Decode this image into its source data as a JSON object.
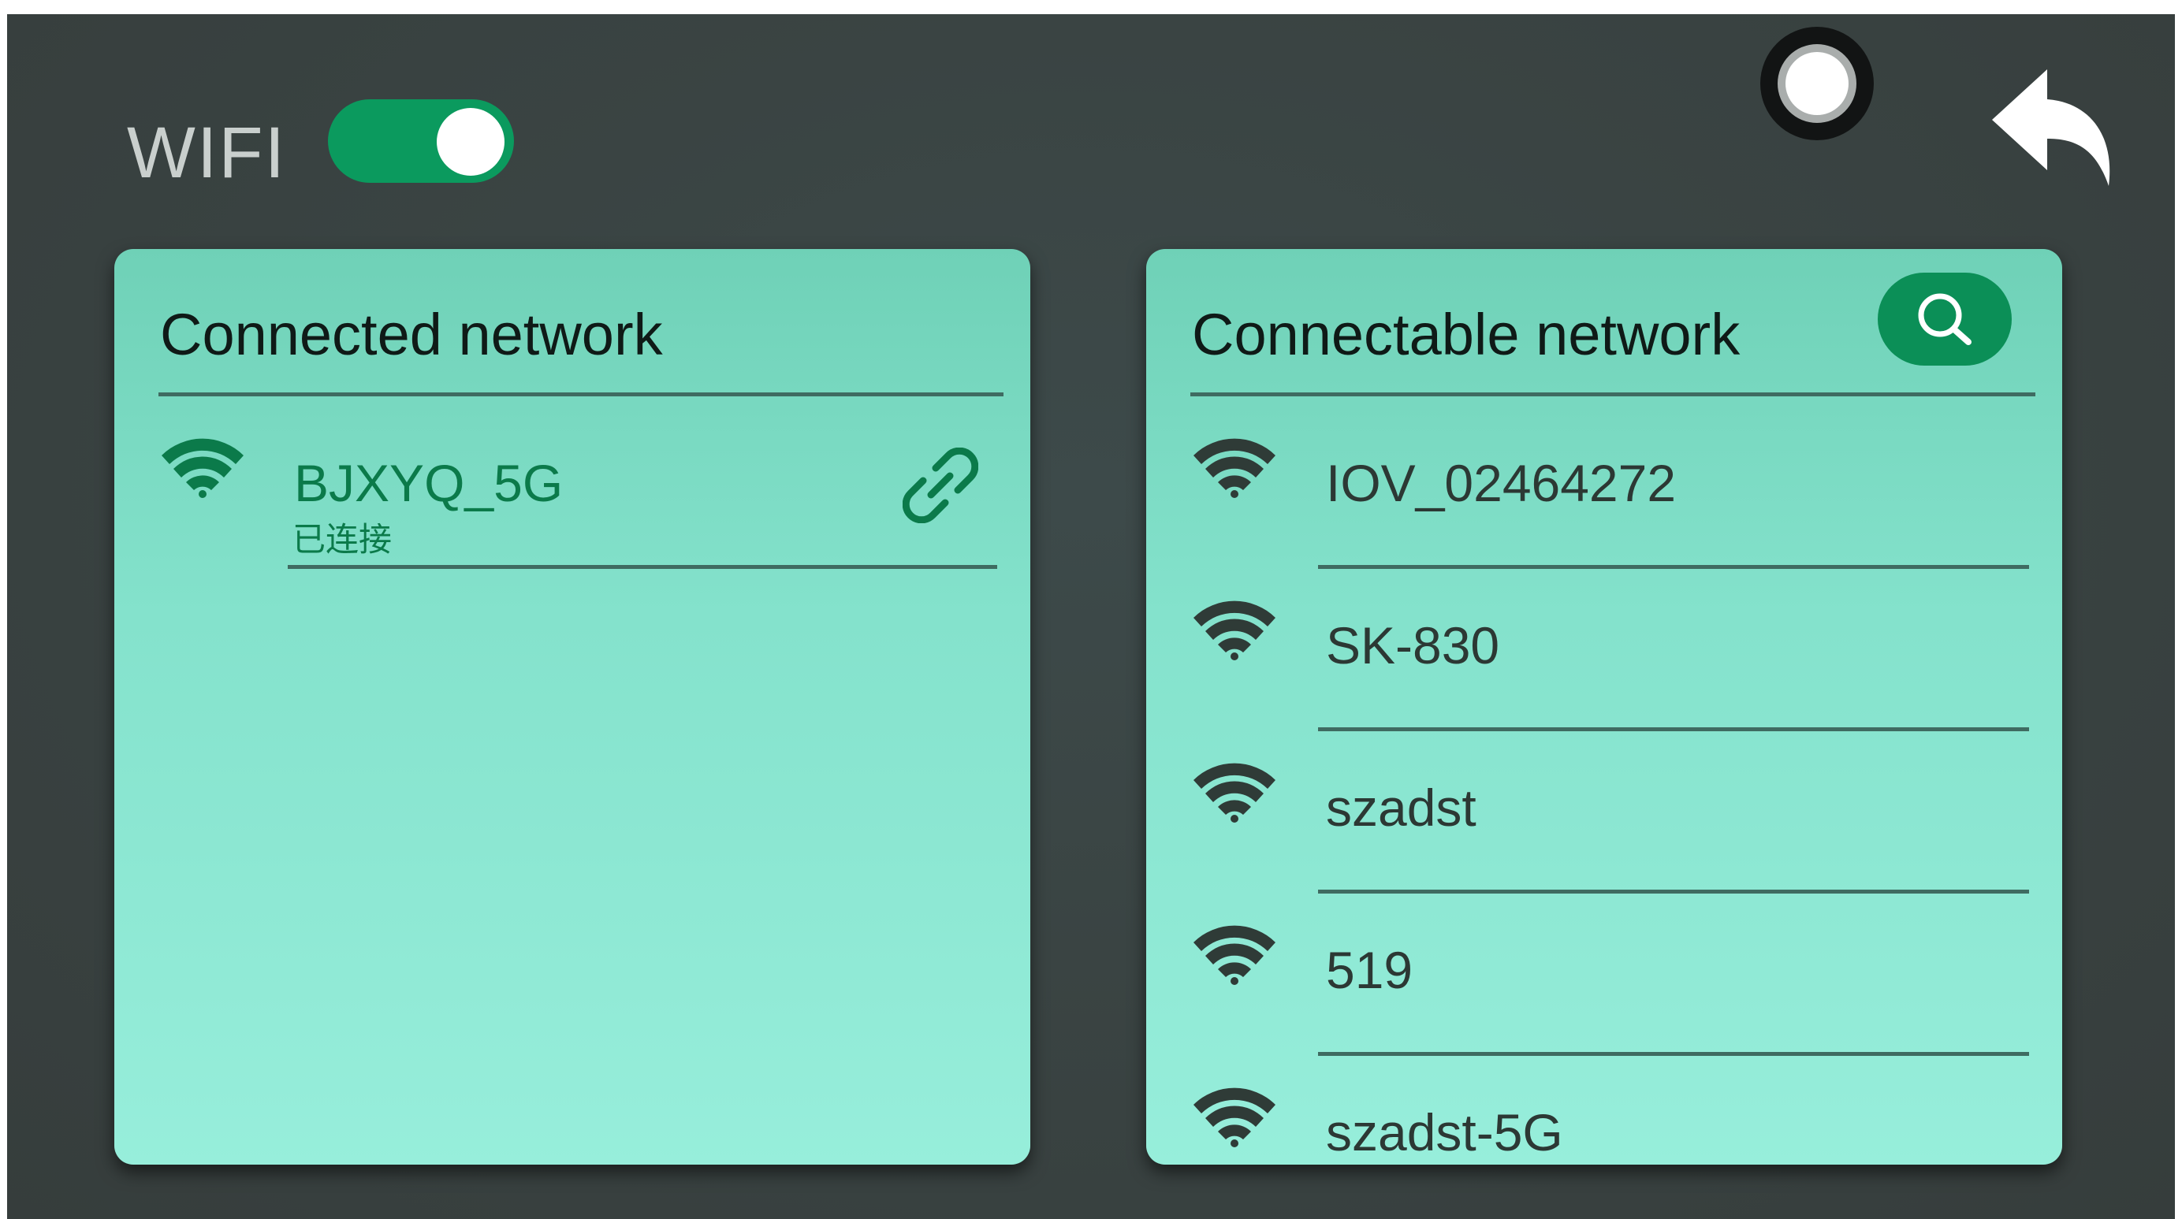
{
  "header": {
    "wifi_label": "WIFI",
    "wifi_enabled": true
  },
  "colors": {
    "accent_green": "#0b9a5e",
    "panel_teal": "#84e2cc",
    "background": "#3a4443"
  },
  "icons": {
    "record": "record-button-icon",
    "back": "back-arrow-icon",
    "search": "search-icon",
    "wifi": "wifi-signal-icon",
    "link": "link-icon"
  },
  "connected_panel": {
    "title": "Connected network",
    "networks": [
      {
        "ssid": "BJXYQ_5G",
        "status": "已连接"
      }
    ]
  },
  "connectable_panel": {
    "title": "Connectable network",
    "networks": [
      {
        "ssid": "IOV_02464272"
      },
      {
        "ssid": "SK-830"
      },
      {
        "ssid": "szadst"
      },
      {
        "ssid": "519"
      },
      {
        "ssid": "szadst-5G"
      }
    ]
  }
}
